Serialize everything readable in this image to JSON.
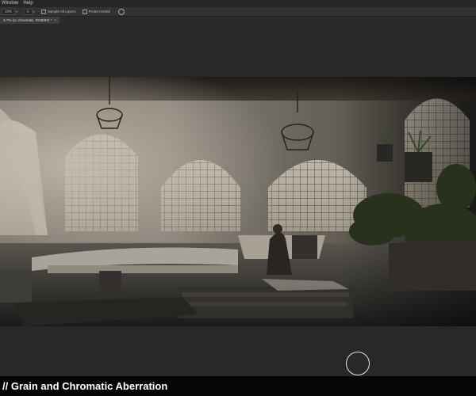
{
  "menubar": {
    "items": [
      "Window",
      "Help"
    ]
  },
  "options_bar": {
    "zoom_value": "10%",
    "mode_value": "0",
    "sample_all_layers_label": "Sample All Layers",
    "protect_detail_label": "Protect Detail",
    "icon": "settings-gear-icon"
  },
  "document_tab": {
    "title": "4.7% (cc chromatic, RGB/8#) *",
    "close": "×"
  },
  "artwork": {
    "description_icon": "painting",
    "colors": {
      "shadow": "#1a1916",
      "light": "#f2e7cf",
      "plant": "#2c3a1f"
    }
  },
  "caption": {
    "text": "// Grain and Chromatic Aberration"
  }
}
